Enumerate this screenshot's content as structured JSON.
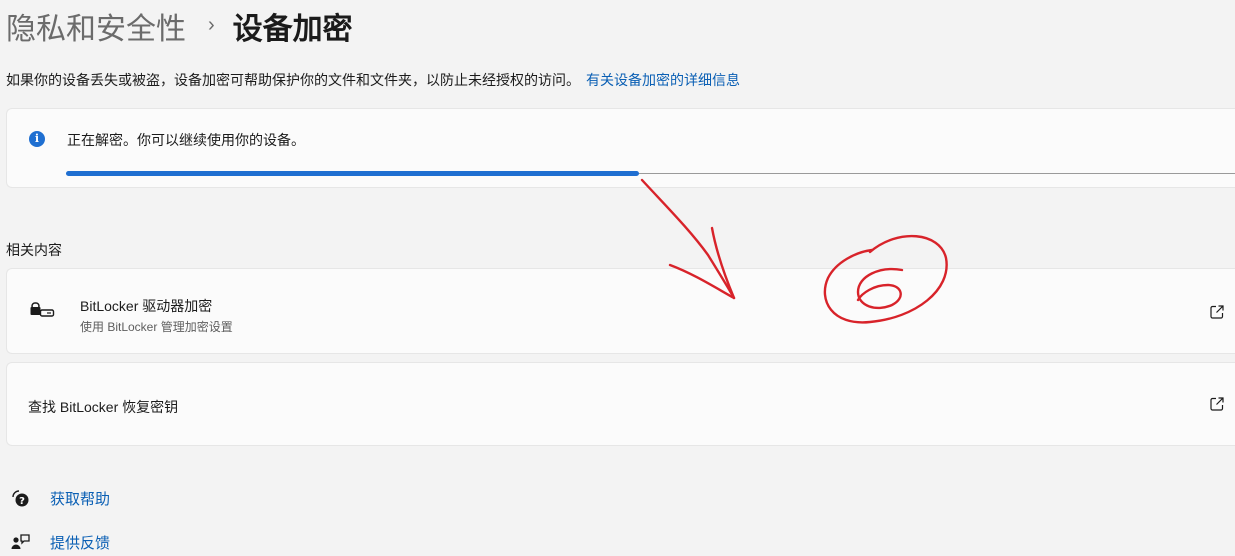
{
  "header": {
    "parent": "隐私和安全性",
    "separator": "›",
    "current": "设备加密"
  },
  "intro": {
    "text": "如果你的设备丢失或被盗，设备加密可帮助保护你的文件和文件夹，以防止未经授权的访问。",
    "link": "有关设备加密的详细信息"
  },
  "status": {
    "message": "正在解密。你可以继续使用你的设备。",
    "progress": 0.49,
    "accent_color": "#1f6fd1"
  },
  "related": {
    "heading": "相关内容",
    "items": [
      {
        "title": "BitLocker 驱动器加密",
        "subtitle": "使用 BitLocker 管理加密设置",
        "icon": "drive-lock-icon",
        "action_icon": "open-external-icon"
      },
      {
        "title": "查找 BitLocker 恢复密钥",
        "action_icon": "open-external-icon"
      }
    ]
  },
  "footer": {
    "get_help": "获取帮助",
    "feedback": "提供反馈"
  },
  "annotation": {
    "handwritten_number": "6",
    "ink_color": "#d8232a"
  }
}
